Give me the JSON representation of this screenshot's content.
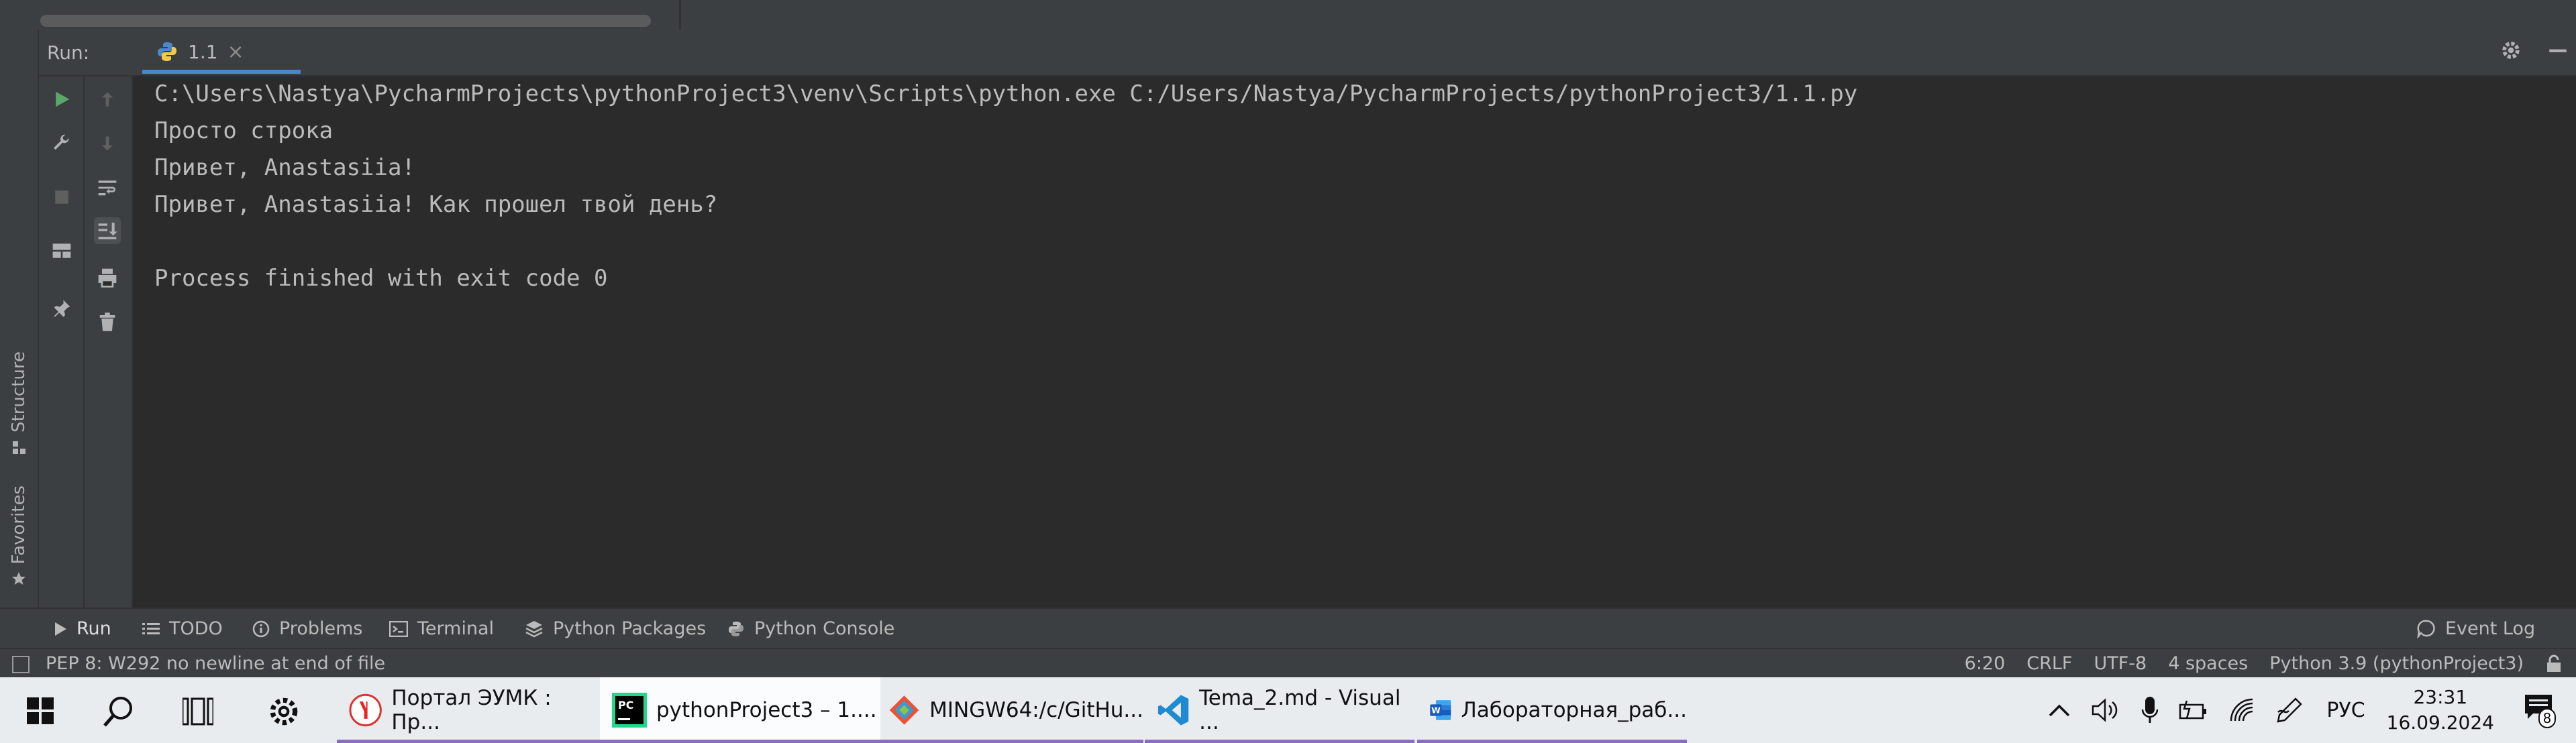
{
  "run_panel": {
    "label": "Run:",
    "tab_name": "1.1",
    "tab_close": "×"
  },
  "side_tabs": {
    "structure": "Structure",
    "favorites": "Favorites"
  },
  "console": {
    "lines": [
      "C:\\Users\\Nastya\\PycharmProjects\\pythonProject3\\venv\\Scripts\\python.exe C:/Users/Nastya/PycharmProjects/pythonProject3/1.1.py",
      "Просто строка",
      "Привет, Anastasiia!",
      "Привет, Anastasiia! Как прошел твой день?",
      "",
      "Process finished with exit code 0"
    ]
  },
  "bottom_tabs": {
    "run": "Run",
    "todo": "TODO",
    "problems": "Problems",
    "terminal": "Terminal",
    "python_packages": "Python Packages",
    "python_console": "Python Console",
    "event_log": "Event Log"
  },
  "status": {
    "message": "PEP 8: W292 no newline at end of file",
    "position": "6:20",
    "line_sep": "CRLF",
    "encoding": "UTF-8",
    "indent": "4 spaces",
    "interpreter": "Python 3.9 (pythonProject3)"
  },
  "taskbar": {
    "apps": [
      {
        "label": "Портал ЭУМК : Пр..."
      },
      {
        "label": "pythonProject3 – 1...."
      },
      {
        "label": "MINGW64:/c/GitHu..."
      },
      {
        "label": "Tema_2.md - Visual ..."
      },
      {
        "label": "Лабораторная_раб..."
      }
    ],
    "language": "РУС",
    "time": "23:31",
    "date": "16.09.2024",
    "notifications": "8"
  },
  "colors": {
    "ide_bg": "#2b2b2b",
    "panel_bg": "#3c3f41",
    "accent": "#4a88c7",
    "run_green": "#59a869",
    "taskbar_bg": "#e8ecef"
  }
}
